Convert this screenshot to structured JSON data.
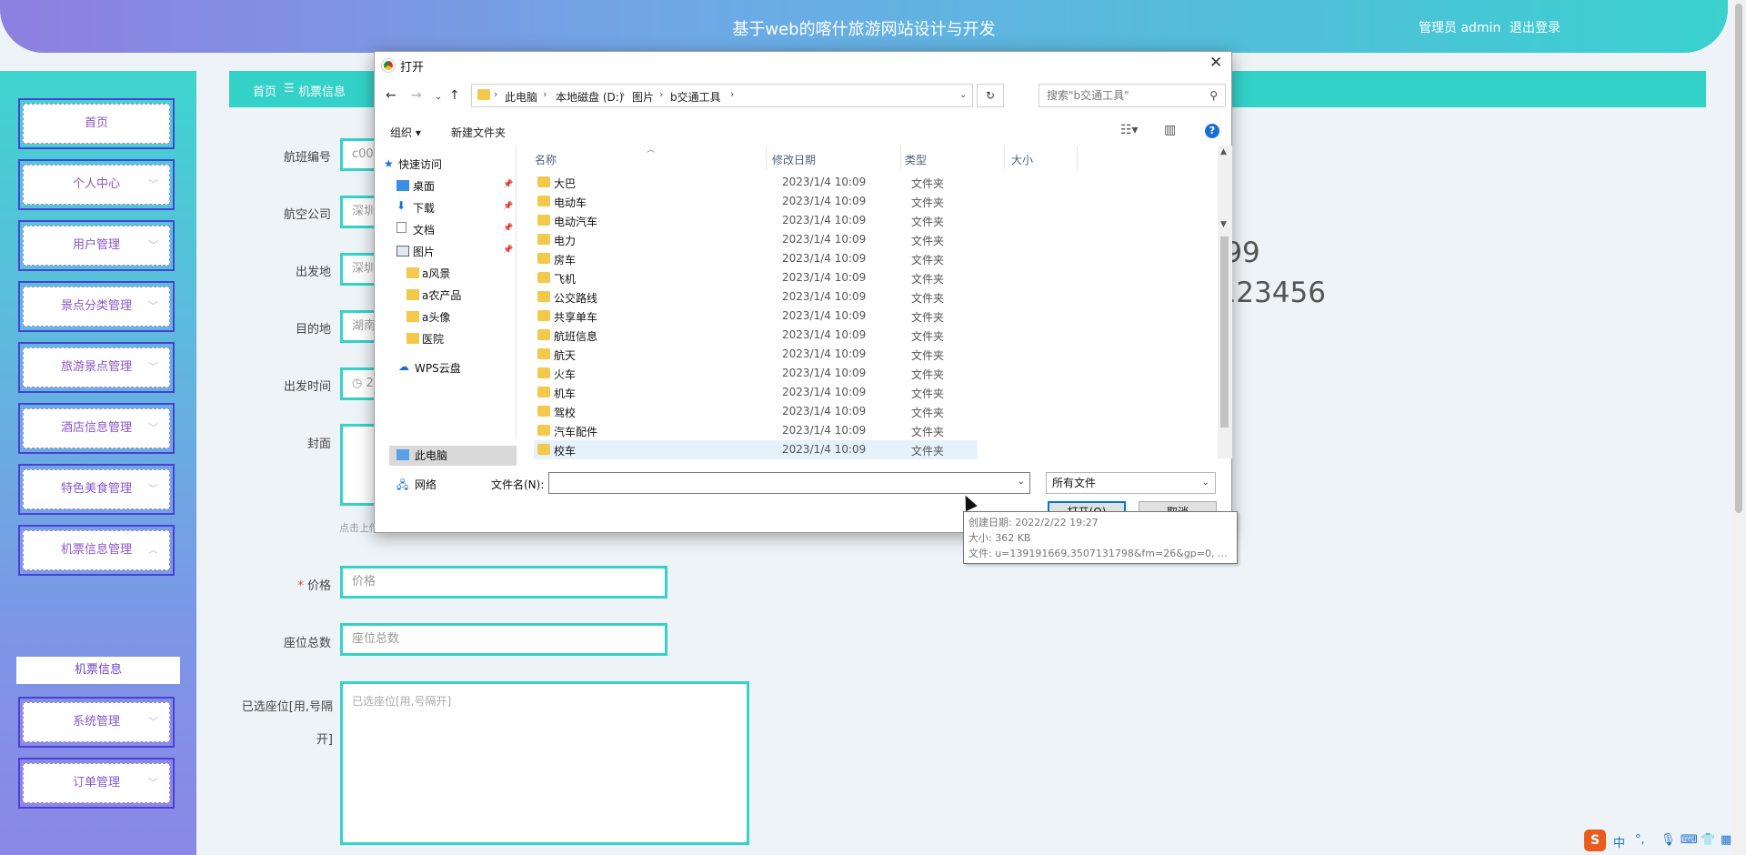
{
  "header": {
    "title": "基于web的喀什旅游网站设计与开发",
    "user_label": "管理员 admin",
    "logout_label": "退出登录"
  },
  "sidebar": {
    "items": [
      {
        "label": "首页",
        "chevron": ""
      },
      {
        "label": "个人中心",
        "chevron": "﹀"
      },
      {
        "label": "用户管理",
        "chevron": "﹀"
      },
      {
        "label": "景点分类管理",
        "chevron": "﹀"
      },
      {
        "label": "旅游景点管理",
        "chevron": "﹀"
      },
      {
        "label": "酒店信息管理",
        "chevron": "﹀"
      },
      {
        "label": "特色美食管理",
        "chevron": "﹀"
      },
      {
        "label": "机票信息管理",
        "chevron": "︿"
      },
      {
        "label": "系统管理",
        "chevron": "﹀"
      },
      {
        "label": "订单管理",
        "chevron": "﹀"
      }
    ],
    "submenu_label": "机票信息"
  },
  "breadcrumb": {
    "home": "首页",
    "separator": "☰",
    "current": "机票信息"
  },
  "form": {
    "flight_no_label": "航班编号",
    "flight_no_value": "c002",
    "airline_label": "航空公司",
    "airline_value": "深圳",
    "departure_label": "出发地",
    "departure_value": "深圳",
    "destination_label": "目的地",
    "destination_value": "湖南",
    "depart_time_label": "出发时间",
    "depart_time_value": "2",
    "cover_label": "封面",
    "cover_hint": "点击上传",
    "price_required": "*",
    "price_label": "价格",
    "price_placeholder": "价格",
    "seats_label": "座位总数",
    "seats_placeholder": "座位总数",
    "selected_label_line1": "已选座位[用,号隔",
    "selected_label_line2": "开]",
    "selected_placeholder": "已选座位[用,号隔开]"
  },
  "watermark": {
    "line1": "git:chenqi199",
    "line2": "v x:chen_q123456"
  },
  "dialog": {
    "title": "打开",
    "close": "✕",
    "path": [
      "此电脑",
      "本地磁盘 (D:)",
      "图片",
      "b交通工具"
    ],
    "search_placeholder": "搜索\"b交通工具\"",
    "organize_label": "组织 ▾",
    "new_folder_label": "新建文件夹",
    "nav": [
      {
        "label": "快速访问",
        "pinned": false
      },
      {
        "label": "桌面",
        "pinned": true
      },
      {
        "label": "下载",
        "pinned": true
      },
      {
        "label": "文档",
        "pinned": true
      },
      {
        "label": "图片",
        "pinned": true
      },
      {
        "label": "a风景",
        "pinned": false
      },
      {
        "label": "a农产品",
        "pinned": false
      },
      {
        "label": "a头像",
        "pinned": false
      },
      {
        "label": "医院",
        "pinned": false
      },
      {
        "label": "WPS云盘",
        "pinned": false
      },
      {
        "label": "此电脑",
        "pinned": false
      },
      {
        "label": "网络",
        "pinned": false
      }
    ],
    "columns": {
      "name": "名称",
      "modified": "修改日期",
      "type": "类型",
      "size": "大小"
    },
    "files": [
      {
        "name": "大巴",
        "date": "2023/1/4 10:09",
        "type": "文件夹"
      },
      {
        "name": "电动车",
        "date": "2023/1/4 10:09",
        "type": "文件夹"
      },
      {
        "name": "电动汽车",
        "date": "2023/1/4 10:09",
        "type": "文件夹"
      },
      {
        "name": "电力",
        "date": "2023/1/4 10:09",
        "type": "文件夹"
      },
      {
        "name": "房车",
        "date": "2023/1/4 10:09",
        "type": "文件夹"
      },
      {
        "name": "飞机",
        "date": "2023/1/4 10:09",
        "type": "文件夹"
      },
      {
        "name": "公交路线",
        "date": "2023/1/4 10:09",
        "type": "文件夹"
      },
      {
        "name": "共享单车",
        "date": "2023/1/4 10:09",
        "type": "文件夹"
      },
      {
        "name": "航班信息",
        "date": "2023/1/4 10:09",
        "type": "文件夹"
      },
      {
        "name": "航天",
        "date": "2023/1/4 10:09",
        "type": "文件夹"
      },
      {
        "name": "火车",
        "date": "2023/1/4 10:09",
        "type": "文件夹"
      },
      {
        "name": "机车",
        "date": "2023/1/4 10:09",
        "type": "文件夹"
      },
      {
        "name": "驾校",
        "date": "2023/1/4 10:09",
        "type": "文件夹"
      },
      {
        "name": "汽车配件",
        "date": "2023/1/4 10:09",
        "type": "文件夹"
      },
      {
        "name": "校车",
        "date": "2023/1/4 10:09",
        "type": "文件夹"
      }
    ],
    "filename_label": "文件名(N):",
    "filter_label": "所有文件",
    "open_label": "打开(O)",
    "cancel_label": "取消",
    "tooltip": {
      "created": "创建日期: 2022/2/22 19:27",
      "size": "大小: 362 KB",
      "files": "文件: u=139191669,3507131798&fm=26&gp=0, ..."
    }
  },
  "ime": {
    "logo": "S",
    "mode": "中",
    "punct": "°,"
  },
  "colors": {
    "accent": "#36d2c9",
    "menu_text": "#8a57c8",
    "dialog_primary": "#0078d7"
  }
}
